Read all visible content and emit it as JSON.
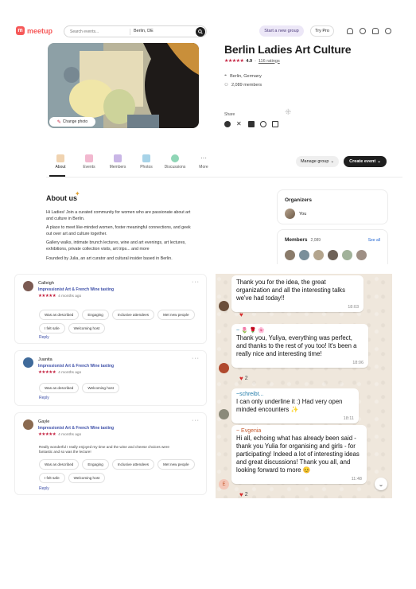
{
  "header": {
    "logo": "meetup",
    "search_placeholder": "Search events...",
    "search_location": "Berlin, DE",
    "start_group_label": "Start a new group",
    "try_pro_label": "Try Pro"
  },
  "group": {
    "title": "Berlin Ladies Art Culture",
    "rating": "4.9",
    "ratings_link": "116 ratings",
    "location": "Berlin, Germany",
    "members": "2,089 members",
    "change_photo": "Change photo",
    "share_label": "Share"
  },
  "tabs": [
    {
      "label": "About"
    },
    {
      "label": "Events"
    },
    {
      "label": "Members"
    },
    {
      "label": "Photos"
    },
    {
      "label": "Discussions"
    },
    {
      "label": "More"
    }
  ],
  "actions": {
    "manage": "Manage group",
    "create": "Create event"
  },
  "about": {
    "title": "About us",
    "paragraphs": [
      "Hi Ladies! Join a curated community for women who are passionate about art and culture in Berlin.",
      "A place to meet like-minded women, foster meaningful connections, and geek out over art and culture together.",
      "Gallery walks, intimate brunch lectures, wine and art evenings, art lectures, exhibitions, private collection visits, art trips... and more",
      "Founded by Julia, an art curator and cultural insider based in Berlin."
    ]
  },
  "organizers": {
    "title": "Organizers",
    "name": "You"
  },
  "members_card": {
    "title": "Members",
    "count": "2,089",
    "see_all": "See all"
  },
  "reviews": [
    {
      "name": "Calleigh",
      "event": "Impressionist Art & French Wine tasting",
      "when": "4 months ago",
      "text": "",
      "chips": [
        "Was as described",
        "Engaging",
        "Inclusive attendees",
        "Met new people",
        "I felt safe",
        "Welcoming host"
      ],
      "reply": "Reply"
    },
    {
      "name": "Juanita",
      "event": "Impressionist Art & French Wine tasting",
      "when": "4 months ago",
      "text": "",
      "chips": [
        "Was as described",
        "Welcoming host"
      ],
      "reply": "Reply"
    },
    {
      "name": "Gayle",
      "event": "Impressionist Art & French Wine tasting",
      "when": "4 months ago",
      "text": "Really wonderful I really enjoyed my time and the wine and cheese choices were fantastic and so was the lecture!",
      "chips": [
        "Was as described",
        "Engaging",
        "Inclusive attendees",
        "Met new people",
        "I felt safe",
        "Welcoming host"
      ],
      "reply": "Reply"
    }
  ],
  "chat": [
    {
      "sender": "",
      "text": "Thank you for the idea, the great organization and all the interesting talks we've had today!!",
      "time": "18:03",
      "reaction": ""
    },
    {
      "sender": "~ 🌷 🌹 🌸",
      "text": "Thank you, Yuliya, everything was perfect, and thanks to the rest of you too! It's been a really nice and interesting time!",
      "time": "18:06",
      "reaction": "2"
    },
    {
      "sender": "~schreibt...",
      "text": "I can only underline it :) Had very open minded encounters ✨",
      "time": "18:11",
      "reaction": ""
    },
    {
      "sender": "~ Evgenia",
      "text": "Hi all, echoing what has already been said - thank you Yulia for organising and girls - for participating! Indeed a lot of interesting ideas and great discussions! Thank you all, and looking forward to more 😊",
      "time": "11:48",
      "reaction": "2"
    }
  ],
  "colors": {
    "brand": "#f65858",
    "star": "#c4213f",
    "link": "#3d4fa8",
    "chat_bg": "#efe7dc"
  }
}
